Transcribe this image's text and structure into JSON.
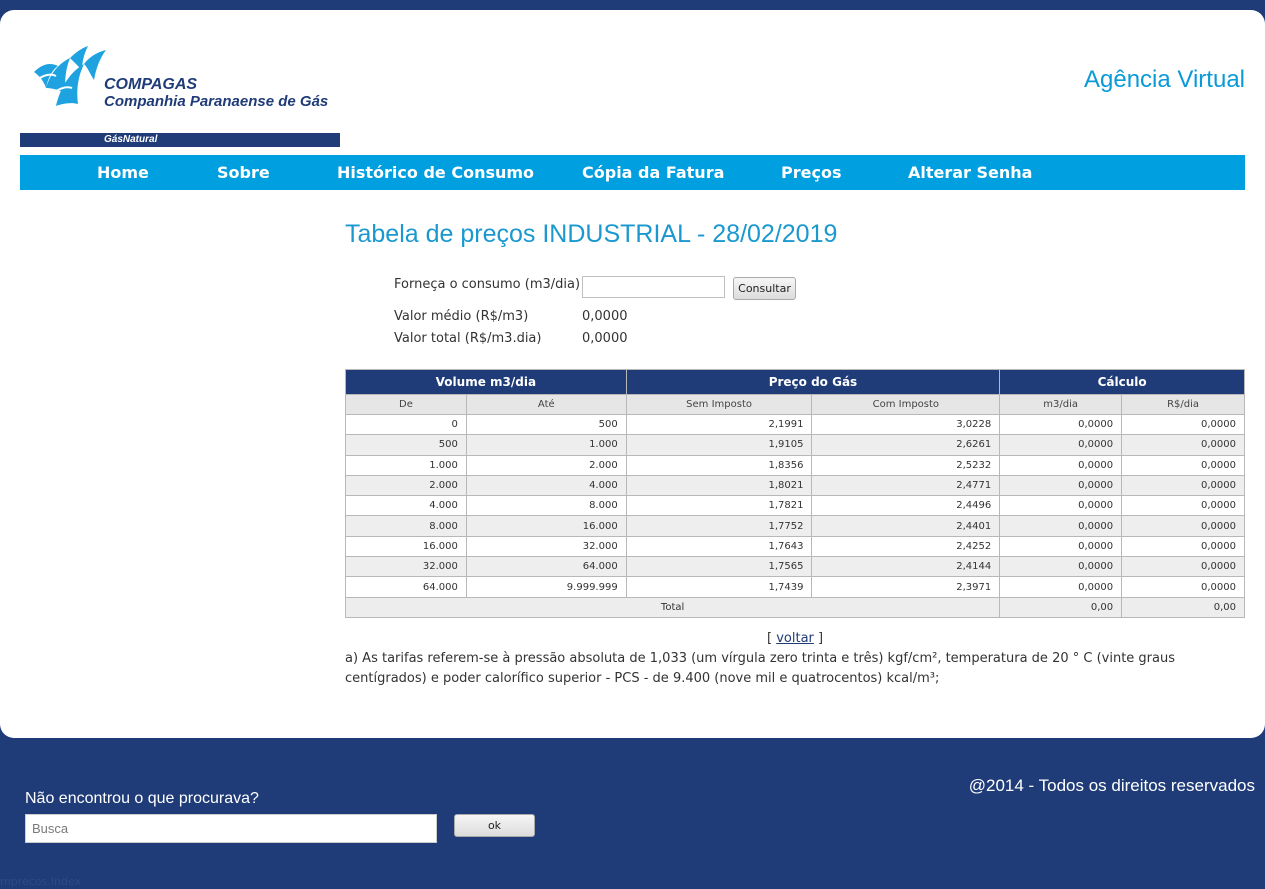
{
  "header": {
    "logo_name": "COMPAGAS",
    "logo_subtitle": "Companhia Paranaense de Gás",
    "logo_tagline": "GásNatural",
    "app_title": "Agência Virtual"
  },
  "nav": {
    "items": [
      {
        "label": "Home"
      },
      {
        "label": "Sobre"
      },
      {
        "label": "Histórico de Consumo"
      },
      {
        "label": "Cópia da Fatura"
      },
      {
        "label": "Preços"
      },
      {
        "label": "Alterar Senha"
      }
    ]
  },
  "main": {
    "title": "Tabela de preços INDUSTRIAL - 28/02/2019",
    "form": {
      "consumo_label": "Forneça o consumo (m3/dia)",
      "consumo_value": "",
      "consultar_label": "Consultar",
      "valor_medio_label": "Valor médio (R$/m3)",
      "valor_medio": "0,0000",
      "valor_total_label": "Valor total (R$/m3.dia)",
      "valor_total": "0,0000"
    },
    "table": {
      "groups": [
        "Volume m3/dia",
        "Preço do Gás",
        "Cálculo"
      ],
      "columns": [
        "De",
        "Até",
        "Sem Imposto",
        "Com Imposto",
        "m3/dia",
        "R$/dia"
      ],
      "rows": [
        [
          "0",
          "500",
          "2,1991",
          "3,0228",
          "0,0000",
          "0,0000"
        ],
        [
          "500",
          "1.000",
          "1,9105",
          "2,6261",
          "0,0000",
          "0,0000"
        ],
        [
          "1.000",
          "2.000",
          "1,8356",
          "2,5232",
          "0,0000",
          "0,0000"
        ],
        [
          "2.000",
          "4.000",
          "1,8021",
          "2,4771",
          "0,0000",
          "0,0000"
        ],
        [
          "4.000",
          "8.000",
          "1,7821",
          "2,4496",
          "0,0000",
          "0,0000"
        ],
        [
          "8.000",
          "16.000",
          "1,7752",
          "2,4401",
          "0,0000",
          "0,0000"
        ],
        [
          "16.000",
          "32.000",
          "1,7643",
          "2,4252",
          "0,0000",
          "0,0000"
        ],
        [
          "32.000",
          "64.000",
          "1,7565",
          "2,4144",
          "0,0000",
          "0,0000"
        ],
        [
          "64.000",
          "9.999.999",
          "1,7439",
          "2,3971",
          "0,0000",
          "0,0000"
        ]
      ],
      "total_label": "Total",
      "total_m3": "0,00",
      "total_rs": "0,00"
    },
    "voltar": {
      "open": "[ ",
      "label": "voltar",
      "close": " ]"
    },
    "note": "a) As tarifas referem-se à pressão absoluta de 1,033 (um vírgula zero trinta e três) kgf/cm², temperatura de 20 ° C (vinte graus centígrados) e poder calorífico superior - PCS - de 9.400 (nove mil e quatrocentos) kcal/m³;"
  },
  "footer": {
    "copyright": "@2014 - Todos os direitos reservados",
    "search_heading": "Não encontrou o que procurava?",
    "search_placeholder": "Busca",
    "search_button": "ok",
    "route": "mprecos.Index"
  },
  "colors": {
    "background": "#1f3c78",
    "nav": "#009fe0",
    "title": "#1a98cf",
    "table_header": "#1f3c78"
  }
}
